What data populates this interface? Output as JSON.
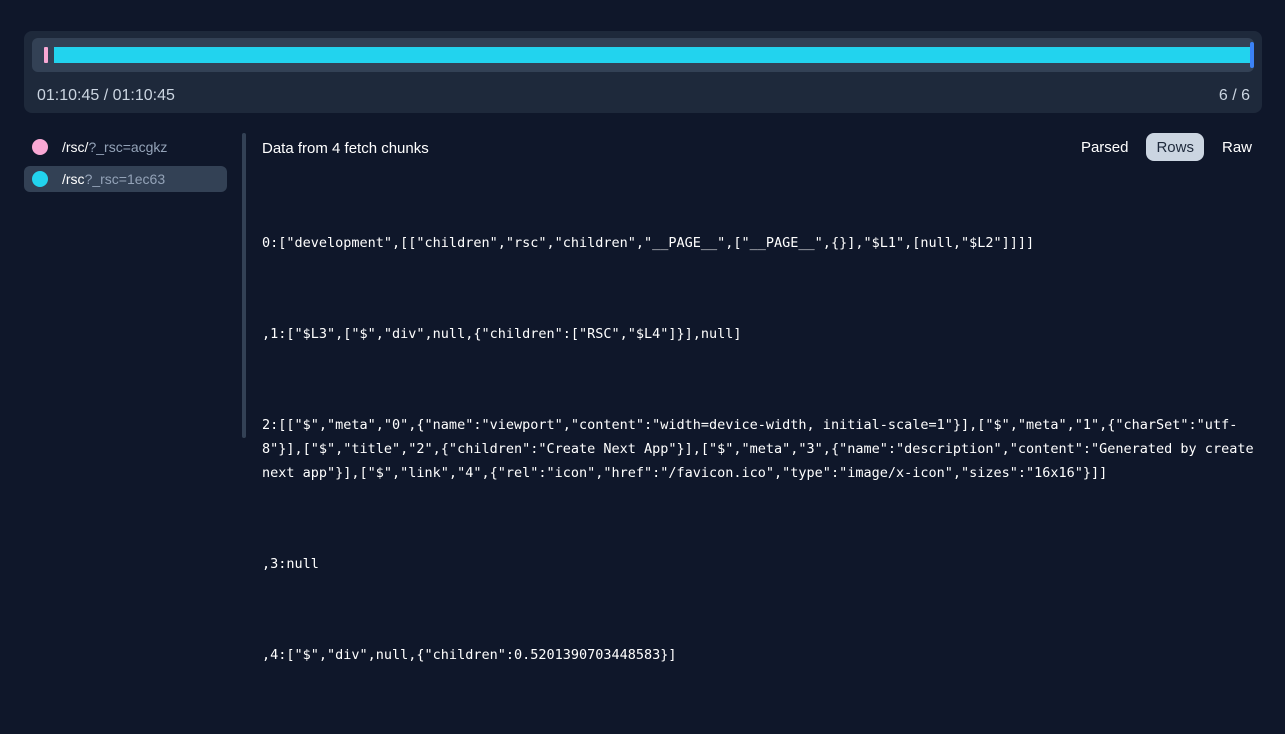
{
  "player": {
    "time": "01:10:45 / 01:10:45",
    "counter": "6 / 6",
    "progress_fraction": 1.0,
    "colors": {
      "chunk_a": "#f9a8d4",
      "chunk_b": "#22d3ee",
      "handle": "#3b82f6"
    }
  },
  "requests": [
    {
      "path": "/rsc/",
      "query": "?_rsc=acgkz",
      "color": "#f9a8d4",
      "active": false
    },
    {
      "path": "/rsc",
      "query": "?_rsc=1ec63",
      "color": "#22d3ee",
      "active": true
    }
  ],
  "panel": {
    "title": "Data from 4 fetch chunks",
    "tabs": [
      {
        "label": "Parsed",
        "active": false
      },
      {
        "label": "Rows",
        "active": true
      },
      {
        "label": "Raw",
        "active": false
      }
    ],
    "rows": [
      "0:[\"development\",[[\"children\",\"rsc\",\"children\",\"__PAGE__\",[\"__PAGE__\",{}],\"$L1\",[null,\"$L2\"]]]]",
      ",1:[\"$L3\",[\"$\",\"div\",null,{\"children\":[\"RSC\",\"$L4\"]}],null]",
      "2:[[\"$\",\"meta\",\"0\",{\"name\":\"viewport\",\"content\":\"width=device-width, initial-scale=1\"}],[\"$\",\"meta\",\"1\",{\"charSet\":\"utf-8\"}],[\"$\",\"title\",\"2\",{\"children\":\"Create Next App\"}],[\"$\",\"meta\",\"3\",{\"name\":\"description\",\"content\":\"Generated by create next app\"}],[\"$\",\"link\",\"4\",{\"rel\":\"icon\",\"href\":\"/favicon.ico\",\"type\":\"image/x-icon\",\"sizes\":\"16x16\"}]]",
      ",3:null",
      ",4:[\"$\",\"div\",null,{\"children\":0.5201390703448583}]"
    ]
  }
}
